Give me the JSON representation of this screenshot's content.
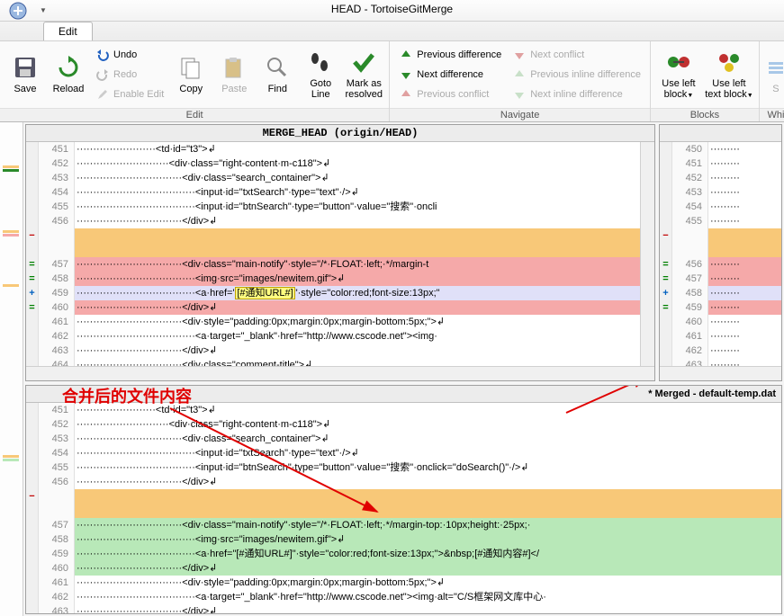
{
  "title": "HEAD - TortoiseGitMerge",
  "tabs": {
    "edit": "Edit"
  },
  "ribbon": {
    "save": "Save",
    "reload": "Reload",
    "undo": "Undo",
    "redo": "Redo",
    "enable_edit": "Enable Edit",
    "copy": "Copy",
    "paste": "Paste",
    "find": "Find",
    "goto": "Goto Line",
    "mark": "Mark as resolved",
    "prev_diff": "Previous difference",
    "next_diff": "Next difference",
    "prev_conf": "Previous conflict",
    "next_conf": "Next conflict",
    "prev_inline": "Previous inline difference",
    "next_inline": "Next inline difference",
    "use_left_block": "Use left block",
    "use_left_text": "Use left text block",
    "wh": "Whi",
    "sh": "S",
    "group_edit": "Edit",
    "group_nav": "Navigate",
    "group_blocks": "Blocks"
  },
  "panes": {
    "top_left_title": "MERGE_HEAD (origin/HEAD)",
    "merged_title": "* Merged - default-temp.dat",
    "annotation": "合并后的文件内容"
  },
  "top_left_lines": [
    {
      "n": "451",
      "g": "",
      "cls": "",
      "t": "························<td·id=\"t3\">↲"
    },
    {
      "n": "452",
      "g": "",
      "cls": "",
      "t": "····························<div·class=\"right-content·m-c118\">↲"
    },
    {
      "n": "453",
      "g": "",
      "cls": "",
      "t": "································<div·class=\"search_container\">↲"
    },
    {
      "n": "454",
      "g": "",
      "cls": "",
      "t": "····································<input·id=\"txtSearch\"·type=\"text\"·/>↲"
    },
    {
      "n": "455",
      "g": "",
      "cls": "",
      "t": "····································<input·id=\"btnSearch\"·type=\"button\"·value=\"搜索\"·oncli"
    },
    {
      "n": "456",
      "g": "",
      "cls": "",
      "t": "································</div>↲"
    },
    {
      "n": "",
      "g": "−",
      "cls": "bg-orange",
      "t": ""
    },
    {
      "n": "",
      "g": "",
      "cls": "bg-orange",
      "t": ""
    },
    {
      "n": "457",
      "g": "=",
      "cls": "bg-red",
      "t": "································<div·class=\"main-notify\"·style=\"/*·FLOAT:·left;·*/margin-t"
    },
    {
      "n": "458",
      "g": "=",
      "cls": "bg-red",
      "t": "····································<img·src=\"images/newitem.gif\">↲"
    },
    {
      "n": "459",
      "g": "+",
      "cls": "bg-lav",
      "t": "····································<a·href=\"[#通知URL#]\"·style=\"color:red;font-size:13px;\"",
      "hl": "[#通知URL#]"
    },
    {
      "n": "460",
      "g": "=",
      "cls": "bg-red",
      "t": "································</div>↲"
    },
    {
      "n": "461",
      "g": "",
      "cls": "",
      "t": "································<div·style=\"padding:0px;margin:0px;margin-bottom:5px;\">↲"
    },
    {
      "n": "462",
      "g": "",
      "cls": "",
      "t": "····································<a·target=\"_blank\"·href=\"http://www.cscode.net\"><img·"
    },
    {
      "n": "463",
      "g": "",
      "cls": "",
      "t": "································</div>↲"
    },
    {
      "n": "464",
      "g": "",
      "cls": "",
      "t": "································<div·class=\"comment-title\">↲"
    }
  ],
  "top_right_lines": [
    {
      "n": "450",
      "g": "",
      "cls": "",
      "t": "·········"
    },
    {
      "n": "451",
      "g": "",
      "cls": "",
      "t": "·········"
    },
    {
      "n": "452",
      "g": "",
      "cls": "",
      "t": "·········"
    },
    {
      "n": "453",
      "g": "",
      "cls": "",
      "t": "·········"
    },
    {
      "n": "454",
      "g": "",
      "cls": "",
      "t": "·········"
    },
    {
      "n": "455",
      "g": "",
      "cls": "",
      "t": "·········"
    },
    {
      "n": "",
      "g": "−",
      "cls": "bg-orange",
      "t": ""
    },
    {
      "n": "",
      "g": "",
      "cls": "bg-orange",
      "t": ""
    },
    {
      "n": "456",
      "g": "=",
      "cls": "bg-red",
      "t": "·········"
    },
    {
      "n": "457",
      "g": "=",
      "cls": "bg-red",
      "t": "·········"
    },
    {
      "n": "458",
      "g": "+",
      "cls": "bg-lav",
      "t": "·········"
    },
    {
      "n": "459",
      "g": "=",
      "cls": "bg-red",
      "t": "·········"
    },
    {
      "n": "460",
      "g": "",
      "cls": "",
      "t": "·········"
    },
    {
      "n": "461",
      "g": "",
      "cls": "",
      "t": "·········"
    },
    {
      "n": "462",
      "g": "",
      "cls": "",
      "t": "·········"
    },
    {
      "n": "463",
      "g": "",
      "cls": "",
      "t": "·········"
    }
  ],
  "bottom_lines": [
    {
      "n": "451",
      "g": "",
      "cls": "",
      "t": "························<td·id=\"t3\">↲"
    },
    {
      "n": "452",
      "g": "",
      "cls": "",
      "t": "····························<div·class=\"right-content·m-c118\">↲"
    },
    {
      "n": "453",
      "g": "",
      "cls": "",
      "t": "································<div·class=\"search_container\">↲"
    },
    {
      "n": "454",
      "g": "",
      "cls": "",
      "t": "····································<input·id=\"txtSearch\"·type=\"text\"·/>↲"
    },
    {
      "n": "455",
      "g": "",
      "cls": "",
      "t": "····································<input·id=\"btnSearch\"·type=\"button\"·value=\"搜索\"·onclick=\"doSearch()\"·/>↲"
    },
    {
      "n": "456",
      "g": "",
      "cls": "",
      "t": "································</div>↲"
    },
    {
      "n": "",
      "g": "−",
      "cls": "bg-orange",
      "t": ""
    },
    {
      "n": "",
      "g": "",
      "cls": "bg-orange",
      "t": ""
    },
    {
      "n": "457",
      "g": "",
      "cls": "bg-green",
      "t": "································<div·class=\"main-notify\"·style=\"/*·FLOAT:·left;·*/margin-top:·10px;height:·25px;·"
    },
    {
      "n": "458",
      "g": "",
      "cls": "bg-green",
      "t": "····································<img·src=\"images/newitem.gif\">↲"
    },
    {
      "n": "459",
      "g": "",
      "cls": "bg-green",
      "t": "····································<a·href=\"[#通知URL#]\"·style=\"color:red;font-size:13px;\">&nbsp;[#通知内容#]</"
    },
    {
      "n": "460",
      "g": "",
      "cls": "bg-green",
      "t": "································</div>↲"
    },
    {
      "n": "461",
      "g": "",
      "cls": "",
      "t": "································<div·style=\"padding:0px;margin:0px;margin-bottom:5px;\">↲"
    },
    {
      "n": "462",
      "g": "",
      "cls": "",
      "t": "····································<a·target=\"_blank\"·href=\"http://www.cscode.net\"><img·alt=\"C/S框架网文库中心·"
    },
    {
      "n": "463",
      "g": "",
      "cls": "",
      "t": "································</div>↲"
    }
  ]
}
